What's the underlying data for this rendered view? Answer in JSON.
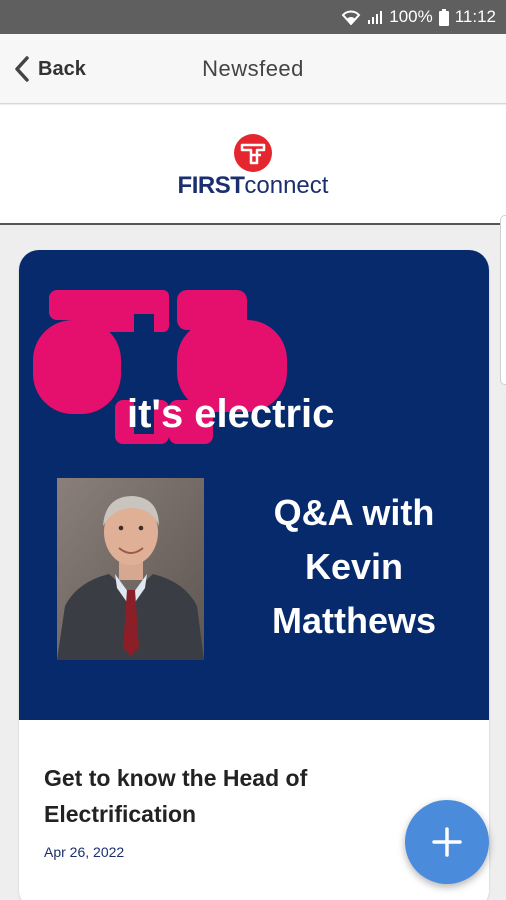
{
  "status_bar": {
    "battery": "100%",
    "time": "11:12",
    "icons": [
      "wifi-icon",
      "signal-icon",
      "battery-icon"
    ]
  },
  "header": {
    "back_label": "Back",
    "title": "Newsfeed"
  },
  "logo": {
    "brand_strong": "FIRST",
    "brand_light": "connect",
    "colors": {
      "mark": "#e6262f",
      "text": "#1b2f6e"
    }
  },
  "post": {
    "image": {
      "headline": "it's electric",
      "qa_line1": "Q&A with",
      "qa_line2": "Kevin",
      "qa_line3": "Matthews",
      "colors": {
        "background": "#072a6d",
        "plug": "#e5106e",
        "text": "#ffffff"
      }
    },
    "title": "Get to know the Head of Electrification",
    "date": "Apr 26, 2022"
  },
  "fab": {
    "icon": "plus-icon",
    "color": "#4a8cdb"
  }
}
